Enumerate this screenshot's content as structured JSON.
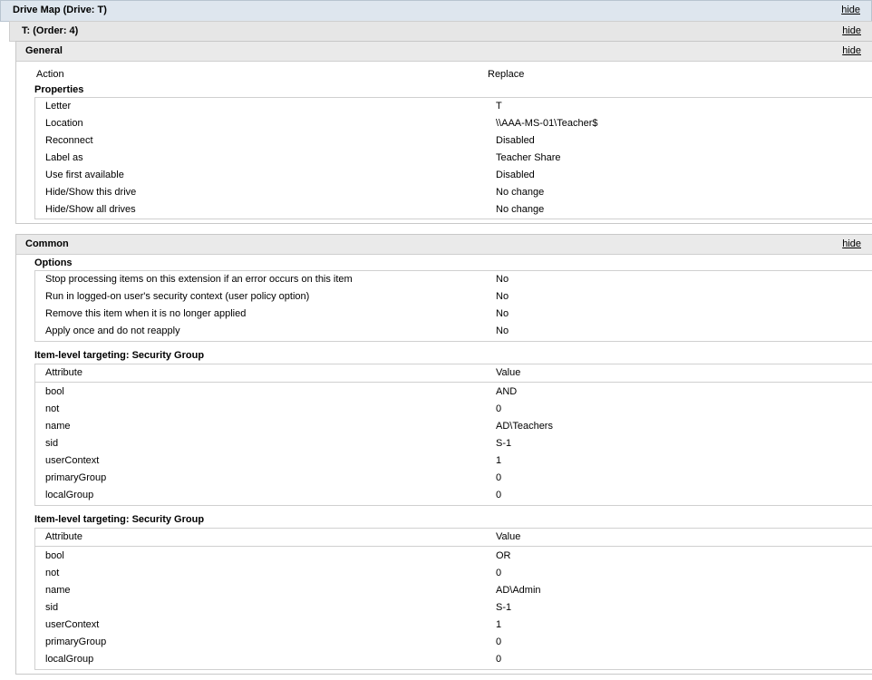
{
  "drive_map": {
    "title": "Drive Map (Drive: T)",
    "hide": "hide"
  },
  "order": {
    "title": "T: (Order: 4)",
    "hide": "hide"
  },
  "general": {
    "title": "General",
    "hide": "hide",
    "action_label": "Action",
    "action_value": "Replace",
    "properties_heading": "Properties",
    "properties": [
      {
        "name": "Letter",
        "value": "T"
      },
      {
        "name": "Location",
        "value": "\\\\AAA-MS-01\\Teacher$"
      },
      {
        "name": "Reconnect",
        "value": "Disabled"
      },
      {
        "name": "Label as",
        "value": "Teacher Share"
      },
      {
        "name": "Use first available",
        "value": "Disabled"
      },
      {
        "name": "Hide/Show this drive",
        "value": "No change"
      },
      {
        "name": "Hide/Show all drives",
        "value": "No change"
      }
    ]
  },
  "common": {
    "title": "Common",
    "hide": "hide",
    "options_heading": "Options",
    "options": [
      {
        "name": "Stop processing items on this extension if an error occurs on this item",
        "value": "No"
      },
      {
        "name": "Run in logged-on user's security context (user policy option)",
        "value": "No"
      },
      {
        "name": "Remove this item when it is no longer applied",
        "value": "No"
      },
      {
        "name": "Apply once and do not reapply",
        "value": "No"
      }
    ],
    "targeting": [
      {
        "heading": "Item-level targeting: Security Group",
        "col_attribute": "Attribute",
        "col_value": "Value",
        "rows": [
          {
            "name": "bool",
            "value": "AND"
          },
          {
            "name": "not",
            "value": "0"
          },
          {
            "name": "name",
            "value": "AD\\Teachers"
          },
          {
            "name": "sid",
            "value": "S-1"
          },
          {
            "name": "userContext",
            "value": "1"
          },
          {
            "name": "primaryGroup",
            "value": "0"
          },
          {
            "name": "localGroup",
            "value": "0"
          }
        ]
      },
      {
        "heading": "Item-level targeting: Security Group",
        "col_attribute": "Attribute",
        "col_value": "Value",
        "rows": [
          {
            "name": "bool",
            "value": "OR"
          },
          {
            "name": "not",
            "value": "0"
          },
          {
            "name": "name",
            "value": "AD\\Admin"
          },
          {
            "name": "sid",
            "value": "S-1"
          },
          {
            "name": "userContext",
            "value": "1"
          },
          {
            "name": "primaryGroup",
            "value": "0"
          },
          {
            "name": "localGroup",
            "value": "0"
          }
        ]
      }
    ]
  }
}
